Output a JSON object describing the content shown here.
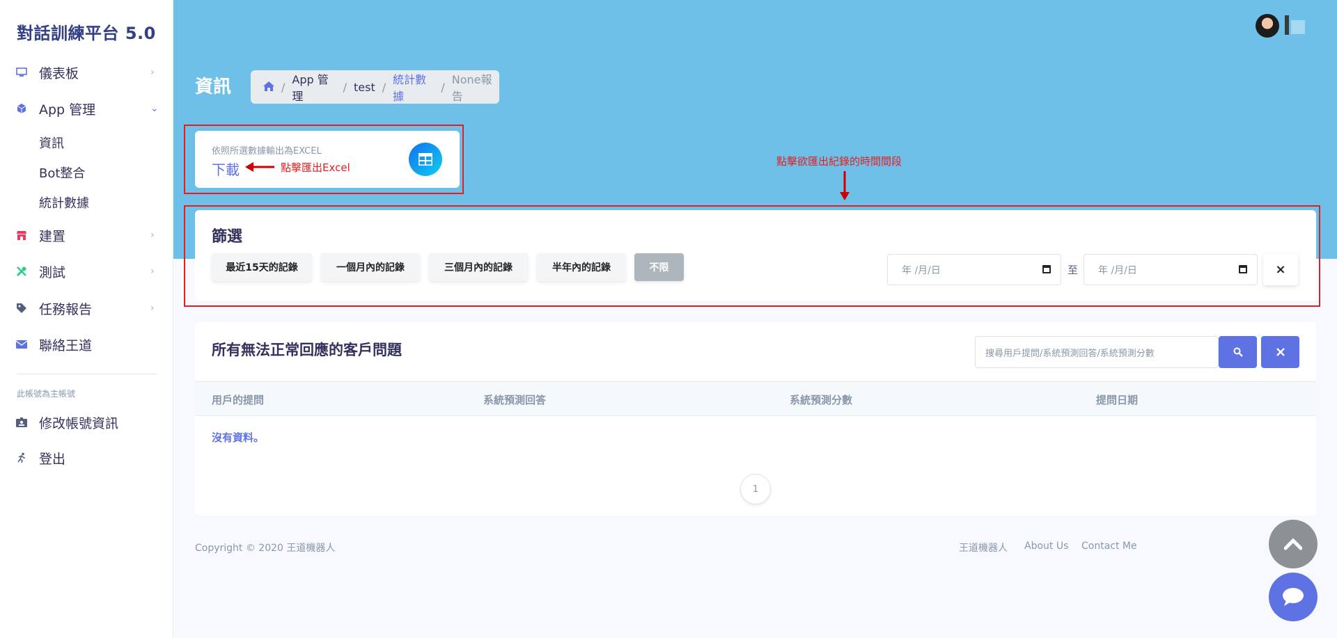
{
  "brand": "對話訓練平台 5.0",
  "sidebar": {
    "items": [
      {
        "label": "儀表板",
        "icon": "monitor-icon"
      },
      {
        "label": "App 管理",
        "icon": "cube-icon"
      },
      {
        "label": "建置",
        "icon": "shop-icon"
      },
      {
        "label": "測試",
        "icon": "tools-icon"
      },
      {
        "label": "任務報告",
        "icon": "tag-icon"
      },
      {
        "label": "聯絡王道",
        "icon": "envelope-icon"
      }
    ],
    "app_sub_items": [
      "資訊",
      "Bot整合",
      "統計數據"
    ],
    "account_heading": "此帳號為主帳號",
    "account_items": [
      {
        "label": "修改帳號資訊",
        "icon": "id-card-icon"
      },
      {
        "label": "登出",
        "icon": "running-icon"
      }
    ]
  },
  "header": {
    "page_title": "資訊",
    "breadcrumb": [
      "App 管理",
      "test",
      "統計數據",
      "None報告"
    ]
  },
  "export_card": {
    "subtitle": "依照所選數據輸出為EXCEL",
    "link": "下載",
    "annotation": "點擊匯出Excel"
  },
  "filter": {
    "annotation": "點擊欲匯出紀錄的時間間段",
    "title": "篩選",
    "buttons": [
      "最近15天的記錄",
      "一個月內的記錄",
      "三個月內的記錄",
      "半年內的記錄",
      "不限"
    ],
    "active_button": "不限",
    "date_from": "年 /月/日",
    "date_to": "年 /月/日",
    "to_label": "至",
    "clear": "×"
  },
  "table": {
    "title": "所有無法正常回應的客戶問題",
    "search_placeholder": "搜尋用戶提問/系統預測回答/系統預測分數",
    "columns": [
      "用戶的提問",
      "系統預測回答",
      "系統預測分數",
      "提問日期"
    ],
    "empty": "沒有資料。",
    "page": "1"
  },
  "footer": {
    "copyright": "Copyright © 2020 王道機器人",
    "links": [
      "王道機器人",
      "About Us",
      "Contact Me"
    ]
  },
  "colors": {
    "header": "#6fc0e8",
    "primary": "#5e72e4",
    "annotation": "#e02020"
  }
}
